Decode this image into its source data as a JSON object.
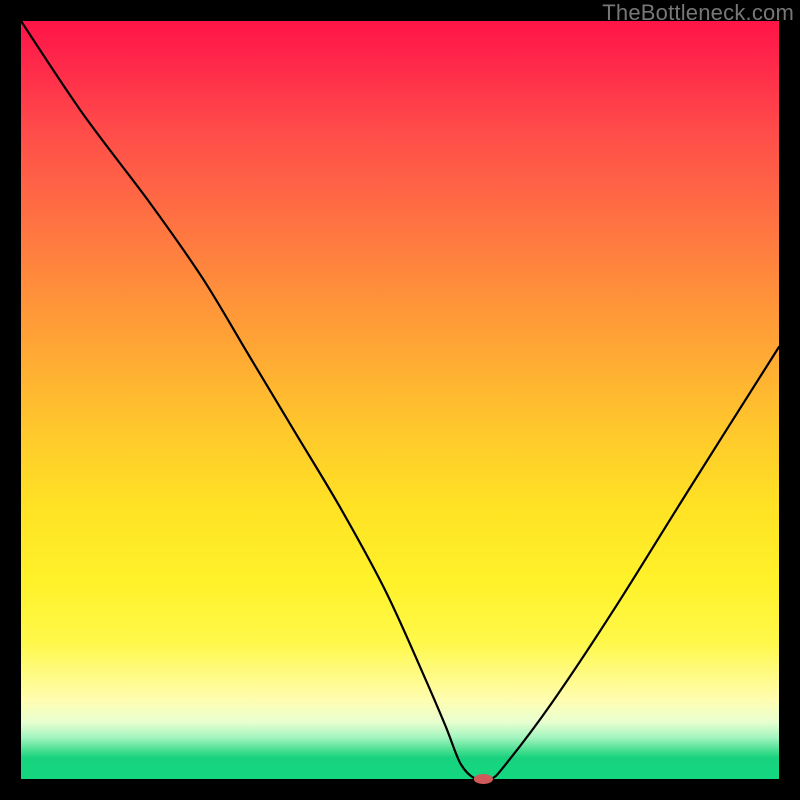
{
  "watermark": "TheBottleneck.com",
  "chart_data": {
    "type": "line",
    "title": "",
    "xlabel": "",
    "ylabel": "",
    "xlim": [
      0,
      100
    ],
    "ylim": [
      0,
      100
    ],
    "grid": false,
    "legend": false,
    "series": [
      {
        "name": "bottleneck-curve",
        "x": [
          0,
          8,
          17,
          24,
          30,
          36,
          42,
          48,
          53,
          56,
          58,
          60,
          62,
          64,
          70,
          78,
          88,
          100
        ],
        "values": [
          100,
          88,
          76,
          66,
          56,
          46,
          36,
          25,
          14,
          7,
          2,
          0,
          0,
          2,
          10,
          22,
          38,
          57
        ]
      }
    ],
    "marker": {
      "x": 61,
      "y": 0,
      "rx": 1.2,
      "ry": 0.6,
      "color": "#d05a5a"
    },
    "background_gradient": {
      "top": "#ff1448",
      "mid_upper": "#ff8a3c",
      "mid": "#ffe224",
      "mid_lower": "#fffdb0",
      "green_band_start": "#a4f5c0",
      "bottom": "#14d880"
    }
  }
}
